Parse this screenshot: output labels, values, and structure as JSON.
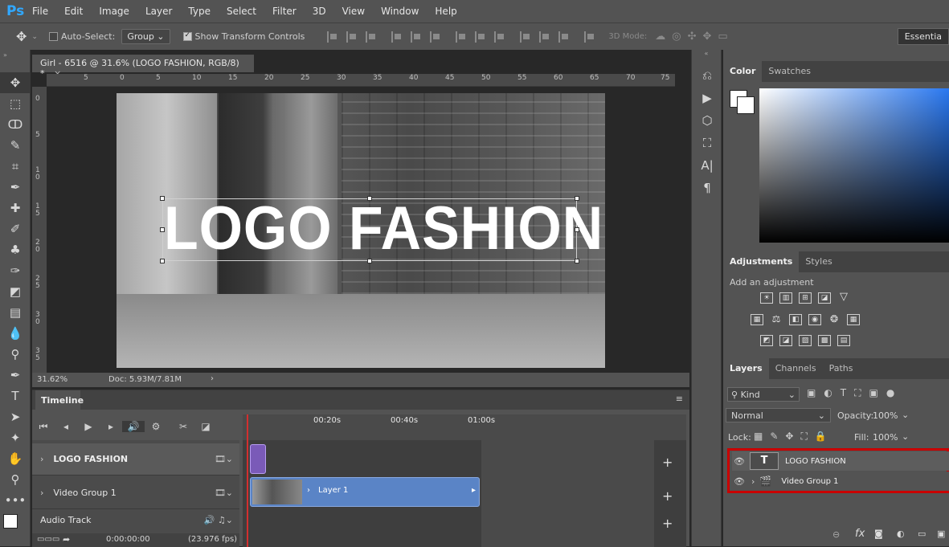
{
  "app": {
    "logo": "Ps"
  },
  "menu": [
    "File",
    "Edit",
    "Image",
    "Layer",
    "Type",
    "Select",
    "Filter",
    "3D",
    "View",
    "Window",
    "Help"
  ],
  "options": {
    "auto_select_label": "Auto-Select:",
    "group_value": "Group",
    "show_transform_label": "Show Transform Controls",
    "mode_3d_label": "3D Mode:",
    "workspace": "Essentia"
  },
  "document": {
    "tab_title": "Girl - 6516 @ 31.6% (LOGO FASHION, RGB/8) *",
    "canvas_text": "LOGO FASHION",
    "zoom": "31.62%",
    "doc_info": "Doc: 5.93M/7.81M"
  },
  "ruler": {
    "top": [
      "5",
      "0",
      "5",
      "10",
      "15",
      "20",
      "25",
      "30",
      "35",
      "40",
      "45",
      "50",
      "55",
      "60",
      "65",
      "70",
      "75"
    ],
    "left": [
      "0",
      "5",
      "1 0",
      "1 5",
      "2 0",
      "2 5",
      "3 0",
      "3 5"
    ]
  },
  "timeline": {
    "title": "Timeline",
    "times": [
      "00:20s",
      "00:40s",
      "01:00s"
    ],
    "tracks": [
      "LOGO FASHION",
      "Video Group 1",
      "Audio Track"
    ],
    "clip_label": "Layer 1",
    "timecode": "0:00:00:00",
    "fps": "(23.976 fps)"
  },
  "color_panel": {
    "tabs": [
      "Color",
      "Swatches"
    ]
  },
  "adjustments": {
    "tabs": [
      "Adjustments",
      "Styles"
    ],
    "add_label": "Add an adjustment"
  },
  "layers_panel": {
    "tabs": [
      "Layers",
      "Channels",
      "Paths"
    ],
    "kind_label": "Kind",
    "blend_mode": "Normal",
    "opacity_label": "Opacity:",
    "opacity_value": "100%",
    "lock_label": "Lock:",
    "fill_label": "Fill:",
    "fill_value": "100%",
    "layers": [
      {
        "name": "LOGO FASHION",
        "type": "text"
      },
      {
        "name": "Video Group 1",
        "type": "video-group"
      }
    ],
    "fx_label": "fx"
  },
  "colors": {
    "accent": "#31a8ff",
    "highlight_box": "#c90000",
    "playhead": "#d32f2f",
    "clip_text": "#7a5ab8",
    "clip_video": "#5a84c6"
  }
}
